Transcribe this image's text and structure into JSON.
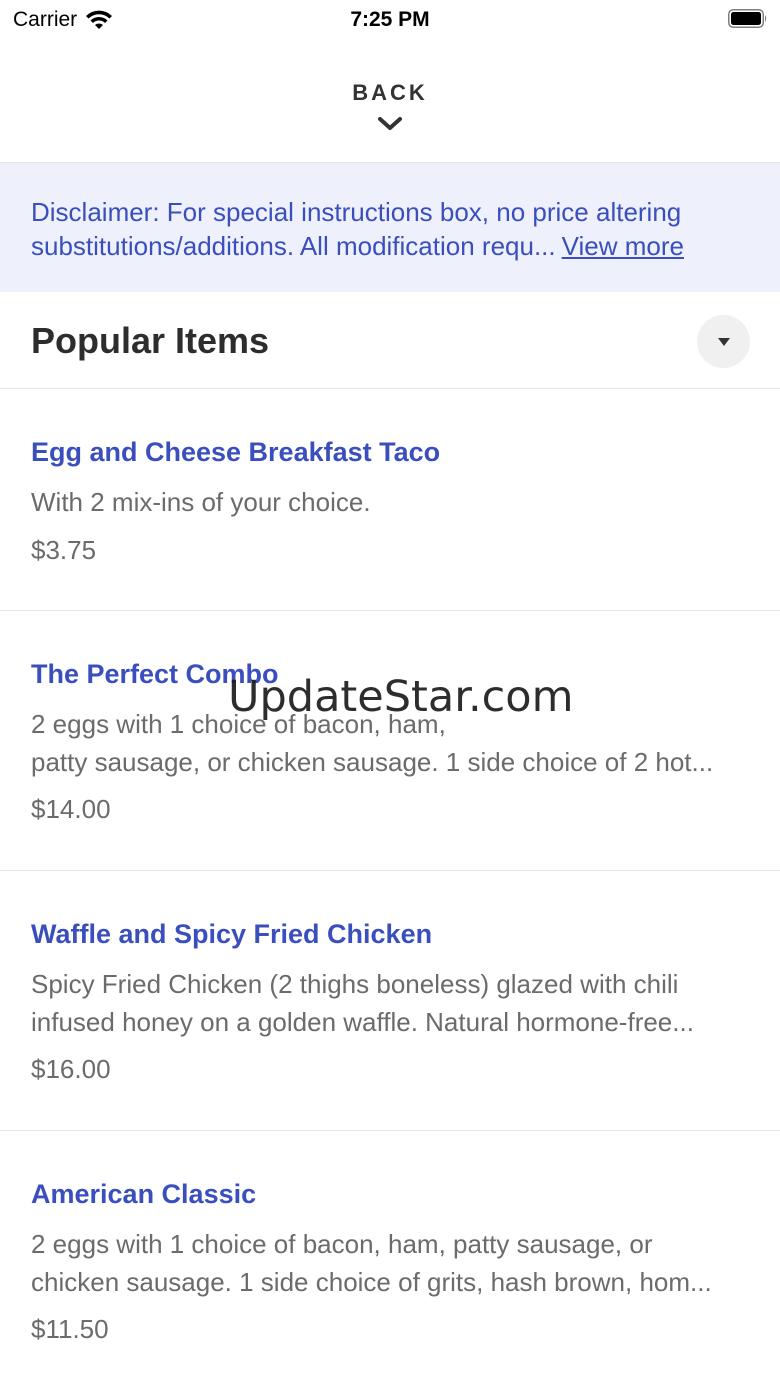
{
  "status_bar": {
    "carrier": "Carrier",
    "time": "7:25 PM",
    "icons": [
      "wifi-icon",
      "battery-icon"
    ]
  },
  "nav": {
    "back_label": "BACK",
    "icon": "chevron-down-icon"
  },
  "disclaimer": {
    "line1": "Disclaimer: For special instructions box, no price altering",
    "line2": "substitutions/additions. All modification requ...",
    "view_more": "View more"
  },
  "section": {
    "title": "Popular Items",
    "toggle_icon": "caret-down-icon"
  },
  "items": [
    {
      "name": "Egg and Cheese Breakfast Taco",
      "desc_lines": [
        "With 2 mix-ins of your choice."
      ],
      "price": "$3.75"
    },
    {
      "name": "The Perfect Combo",
      "desc_lines": [
        "2 eggs with 1 choice of bacon, ham,",
        "patty sausage, or chicken sausage. 1 side choice of 2 hot..."
      ],
      "price": "$14.00"
    },
    {
      "name": "Waffle and Spicy Fried Chicken",
      "desc_lines": [
        "Spicy Fried Chicken (2 thighs boneless) glazed with chili",
        "infused honey on a golden waffle. Natural hormone-free..."
      ],
      "price": "$16.00"
    },
    {
      "name": "American Classic",
      "desc_lines": [
        "2 eggs with 1 choice of bacon, ham, patty sausage, or",
        "chicken sausage. 1 side choice of grits, hash brown, hom..."
      ],
      "price": "$11.50"
    }
  ],
  "watermark": "UpdateStar.com",
  "colors": {
    "accent": "#3a4fbd",
    "disclaimer_bg": "#eef1fb",
    "muted_text": "#6b6b6b"
  }
}
